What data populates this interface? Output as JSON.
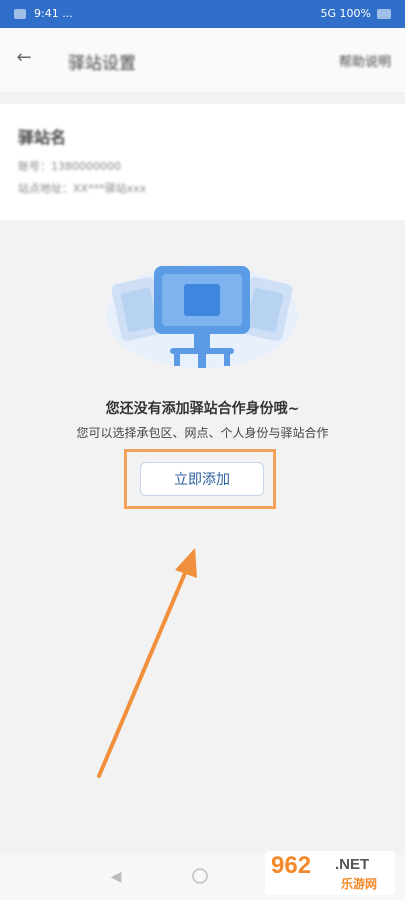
{
  "statusbar": {
    "left": "9:41 ...",
    "right": "5G 100%"
  },
  "header": {
    "back_icon": "back-arrow-icon",
    "title": "驿站设置",
    "action": "帮助说明"
  },
  "info": {
    "name": "驿站名",
    "line1": "账号：1380000000",
    "line2": "站点地址：XX***驿站xxx"
  },
  "empty_state": {
    "title": "您还没有添加驿站合作身份哦~",
    "subtitle": "您可以选择承包区、网点、个人身份与驿站合作",
    "button_label": "立即添加"
  },
  "colors": {
    "status_bar": "#2f6fc9",
    "highlight": "#f3a15a",
    "button_text": "#2c5f9e"
  },
  "watermark": {
    "number": "962",
    "net": ".NET",
    "site": "乐游网"
  }
}
